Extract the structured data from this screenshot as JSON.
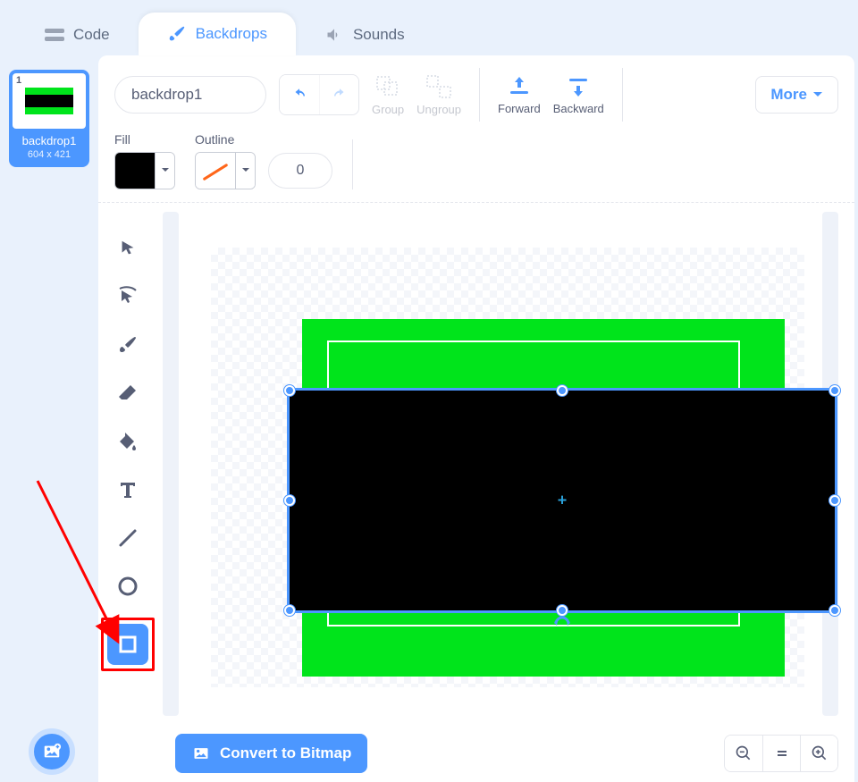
{
  "tabs": {
    "code": "Code",
    "backdrops": "Backdrops",
    "sounds": "Sounds"
  },
  "sidebar": {
    "thumb": {
      "index": "1",
      "name": "backdrop1",
      "dimensions": "604 x 421"
    }
  },
  "toolbar": {
    "name_value": "backdrop1",
    "group": "Group",
    "ungroup": "Ungroup",
    "forward": "Forward",
    "backward": "Backward",
    "more": "More"
  },
  "fill": {
    "fill_label": "Fill",
    "outline_label": "Outline",
    "outline_width": "0",
    "fill_color": "#000000",
    "outline_color": "none"
  },
  "tools": {
    "select": "select",
    "reshape": "reshape",
    "brush": "brush",
    "eraser": "eraser",
    "fill": "fill",
    "text": "text",
    "line": "line",
    "circle": "circle",
    "rectangle": "rectangle"
  },
  "bottom": {
    "convert": "Convert to Bitmap"
  },
  "annotation": {
    "highlight_tool": "rectangle"
  }
}
